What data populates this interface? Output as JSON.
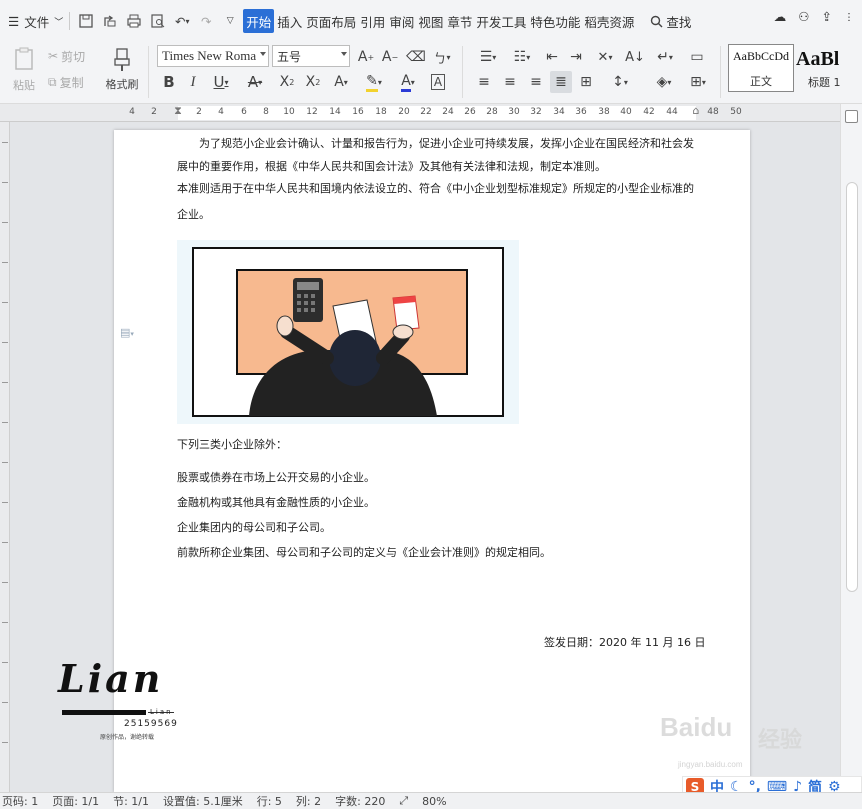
{
  "menu": {
    "file_label": "文件",
    "tabs": [
      {
        "label": "开始",
        "active": true
      },
      {
        "label": "插入"
      },
      {
        "label": "页面布局"
      },
      {
        "label": "引用"
      },
      {
        "label": "审阅"
      },
      {
        "label": "视图"
      },
      {
        "label": "章节"
      },
      {
        "label": "开发工具"
      },
      {
        "label": "特色功能"
      },
      {
        "label": "稻壳资源"
      }
    ],
    "search_label": "查找"
  },
  "ribbon": {
    "paste_label": "粘贴",
    "cut_label": "剪切",
    "copy_label": "复制",
    "format_painter_label": "格式刷",
    "font_name": "Times New Roma",
    "font_size": "五号",
    "style_normal_preview": "AaBbCcDd",
    "style_normal_label": "正文",
    "style_h1_preview": "AaBl",
    "style_h1_label": "标题 1"
  },
  "ruler": {
    "labels": [
      "4",
      "2",
      "2",
      "4",
      "6",
      "8",
      "10",
      "12",
      "14",
      "16",
      "18",
      "20",
      "22",
      "24",
      "26",
      "28",
      "30",
      "32",
      "34",
      "36",
      "38",
      "40",
      "42",
      "44",
      "48",
      "50"
    ]
  },
  "document": {
    "para1": "为了规范小企业会计确认、计量和报告行为，促进小企业可持续发展，发挥小企业在国民经济和社会发展中的重要作用，根据《中华人民共和国会计法》及其他有关法律和法规，制定本准则。",
    "para2": "本准则适用于在中华人民共和国境内依法设立的、符合《中小企业划型标准规定》所规定的小型企业标准的企业。",
    "para3": "下列三类小企业除外：",
    "list": [
      "股票或债券在市场上公开交易的小企业。",
      "金融机构或其他具有金融性质的小企业。",
      "企业集团内的母公司和子公司。"
    ],
    "para4": "前款所称企业集团、母公司和子公司的定义与《企业会计准则》的规定相同。",
    "signature": "签发日期：2020 年 11 月 16 日"
  },
  "watermark": {
    "brand": "Lian",
    "brand_small": "Lian",
    "id": "25159569",
    "note": "原创作品，谢绝转载",
    "baidu": "Baidu",
    "baidu_cn": "经验",
    "baidu_url": "jingyan.baidu.com"
  },
  "ime": {
    "mode": "中",
    "simplified": "简"
  },
  "statusbar": {
    "page_col": "页码: 1",
    "page": "页面: 1/1",
    "section": "节: 1/1",
    "setting": "设置值: 5.1厘米",
    "row": "行: 5",
    "col": "列: 2",
    "words": "字数: 220",
    "zoom": "80%"
  },
  "colors": {
    "accent": "#2b6fd6",
    "desk": "#f7b98f",
    "ime_logo": "#e85b2a"
  }
}
